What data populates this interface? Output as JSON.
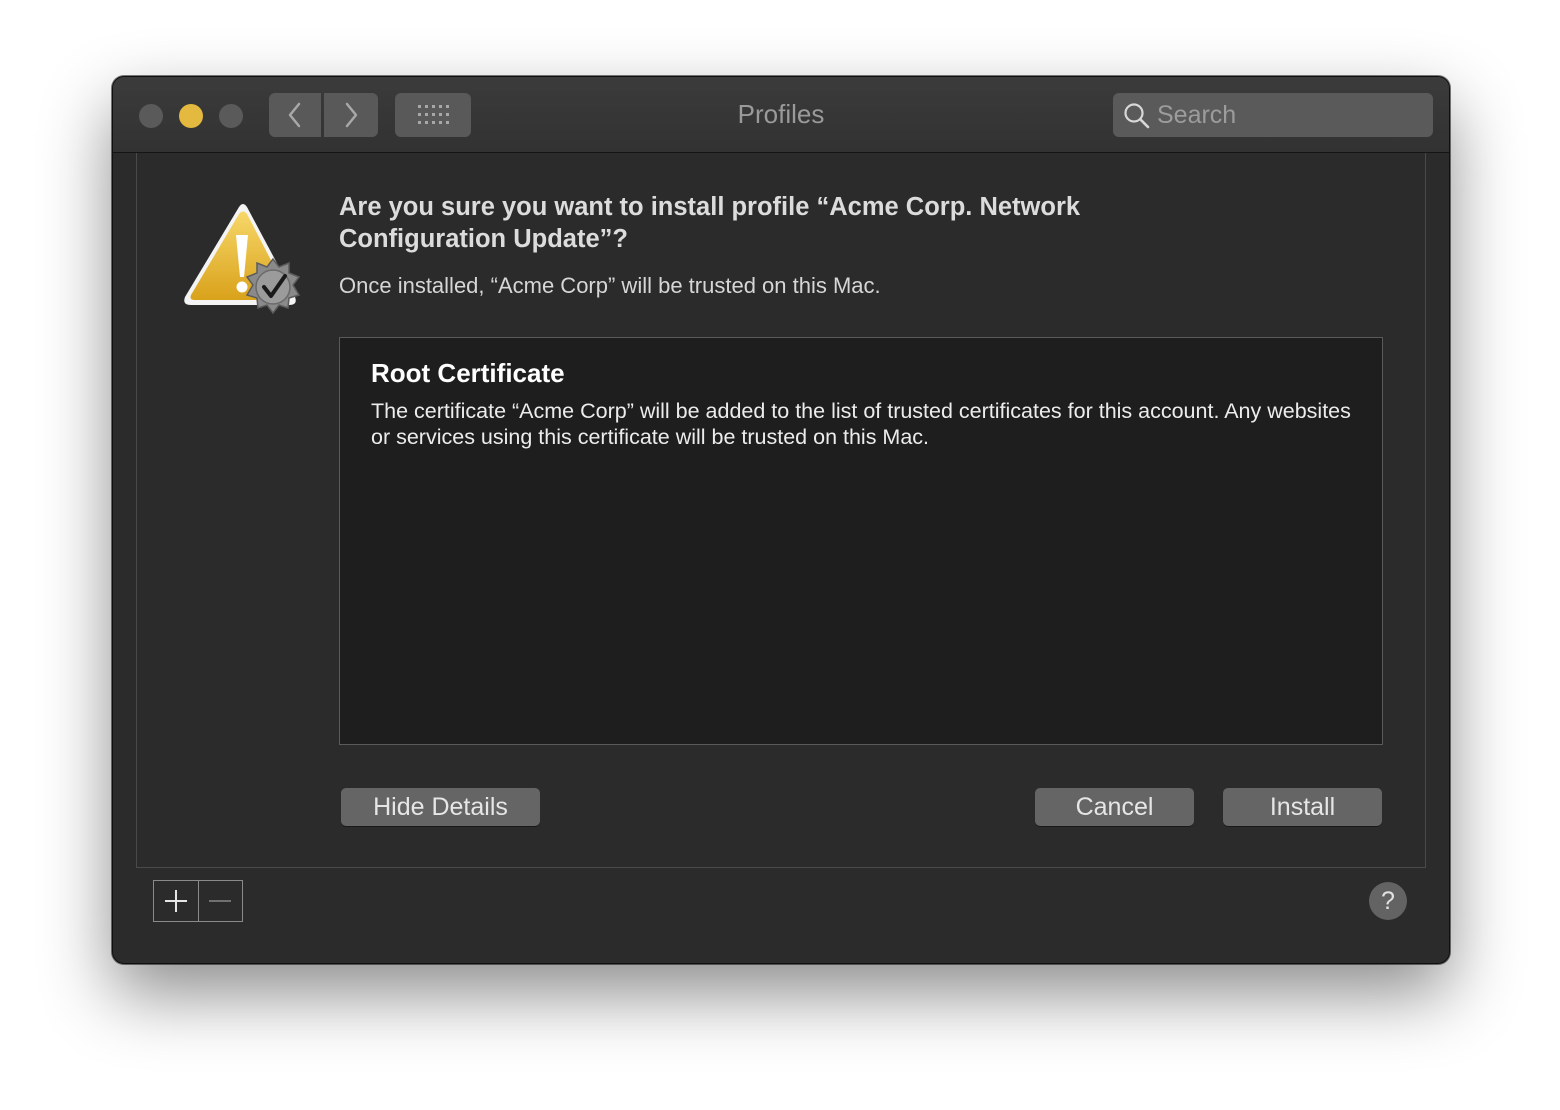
{
  "window": {
    "title": "Profiles",
    "search_placeholder": "Search"
  },
  "toolbar": {
    "back_icon": "chevron-left-icon",
    "forward_icon": "chevron-right-icon",
    "grid_icon": "grid-icon"
  },
  "dialog": {
    "heading": "Are you sure you want to install profile “Acme Corp. Network Configuration Update”?",
    "subtext": "Once installed, “Acme Corp” will be trusted on this Mac.",
    "icon": "warning-badge-icon",
    "details": {
      "title": "Root Certificate",
      "body": "The certificate “Acme Corp” will be added to the list of trusted certificates for this account. Any websites or services using this certificate will be trusted on this Mac."
    },
    "buttons": {
      "hide_details": "Hide Details",
      "cancel": "Cancel",
      "install": "Install"
    }
  },
  "footer": {
    "help_label": "?"
  },
  "colors": {
    "window_bg": "#2b2b2b",
    "details_bg": "#1e1e1e",
    "button_bg": "#656565",
    "minimize_yellow": "#e3b93f"
  }
}
